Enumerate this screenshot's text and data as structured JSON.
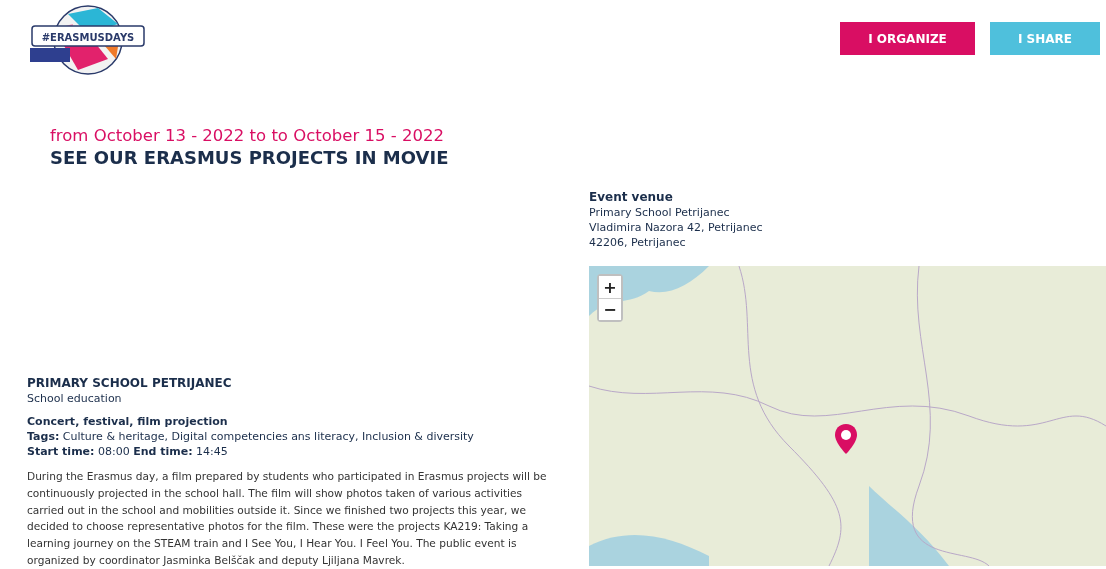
{
  "logo": {
    "text": "#ERASMUSDAYS"
  },
  "buttons": [
    {
      "label": "I ORGANIZE",
      "kind": "primary"
    },
    {
      "label": "I SHARE",
      "kind": "secondary"
    }
  ],
  "event": {
    "dates": "from October 13 - 2022 to to October 15 - 2022",
    "title": "SEE OUR ERASMUS PROJECTS IN MOVIE"
  },
  "organizer": {
    "name": "PRIMARY SCHOOL PETRIJANEC",
    "sector": "School education"
  },
  "details": {
    "type": "Concert, festival, film projection",
    "tags": "**Tags:** Culture & heritage, Digital competencies ans literacy, Inclusion & diversity",
    "times": "**Start time:** 08:00 **End time:** 14:45"
  },
  "description": "During the Erasmus day, a film prepared by students who participated in Erasmus projects will be continuously projected in the school hall. The film will show photos taken of various activities carried out in the school and mobilities outside it. Since we finished two projects this year, we decided to choose representative photos for the film. These were the projects KA219: Taking a learning journey on the STEAM train and I See You, I Hear You. I Feel You. The public event is organized by coordinator Jasminka Belščak and deputy Ljiljana Mavrek.",
  "venue": {
    "heading": "Event venue",
    "lines": [
      "Primary School Petrijanec",
      "Vladimira Nazora 42, Petrijanec",
      "42206, Petrijanec"
    ]
  },
  "map": {
    "zoom_in": "+",
    "zoom_out": "−"
  }
}
